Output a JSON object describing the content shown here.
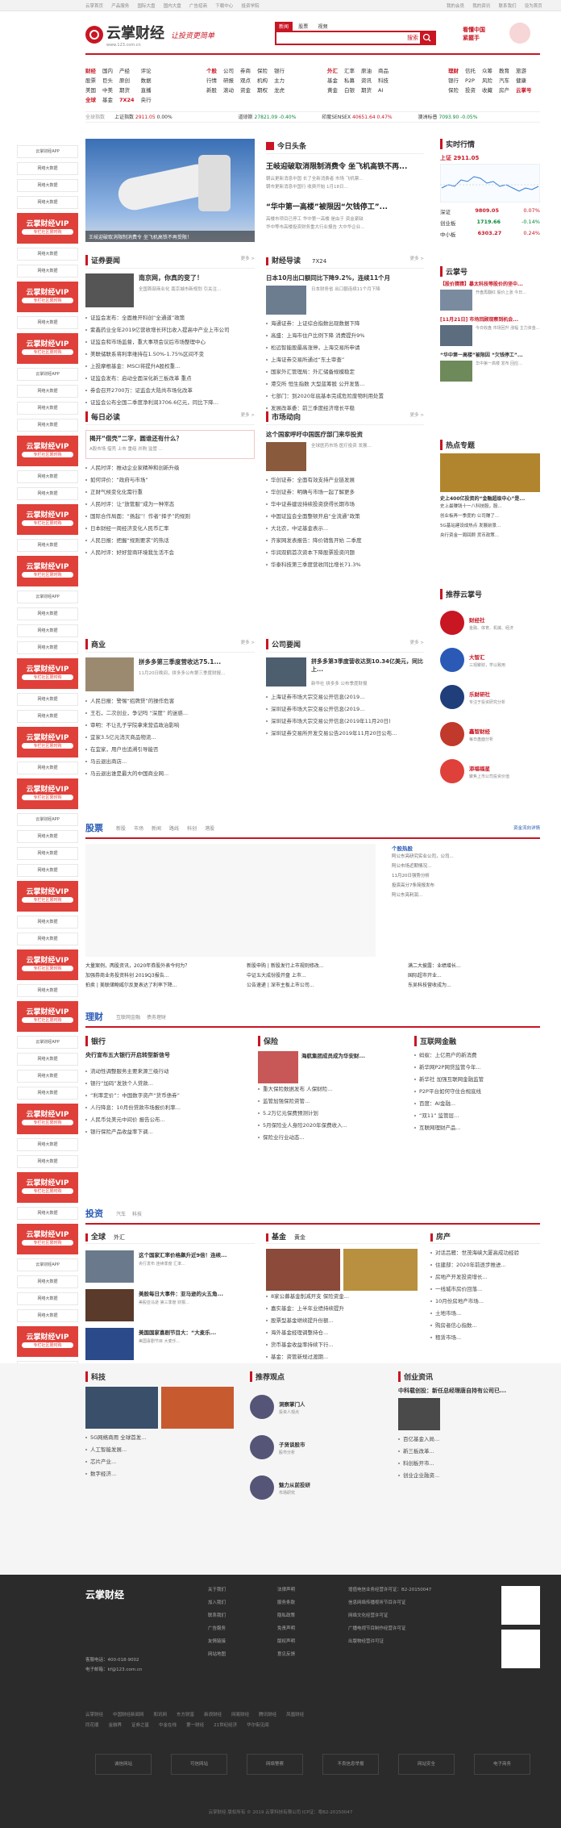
{
  "topbar": {
    "left_links": [
      "云掌首页",
      "产品服务",
      "国际大盘",
      "国内大盘",
      "广告招商",
      "下载中心",
      "投资学院"
    ],
    "right_links": [
      "我的会员",
      "我的资讯",
      "联系我们",
      "设为首页"
    ]
  },
  "brand": {
    "logo_text": "云掌财经",
    "site_url": "www.123.com.cn",
    "slogan": "让投资更简单",
    "accent": "#c81623"
  },
  "search": {
    "tabs": [
      "新闻",
      "股票",
      "视频"
    ],
    "placeholder": "",
    "button": "搜索"
  },
  "promo": {
    "text1": "看懂中国",
    "text2": "紧握手"
  },
  "nav_main": {
    "group1": [
      [
        "财经",
        "股票",
        "美国",
        "全球"
      ],
      [
        "国内",
        "巨头",
        "中美",
        "基金"
      ],
      [
        "产经",
        "原创",
        "期货",
        "7X24"
      ],
      [
        "评论",
        "数据",
        "直播",
        "央行"
      ]
    ],
    "group2": [
      [
        "个股",
        "行情",
        "新股"
      ],
      [
        "公司",
        "研报",
        "滚动"
      ],
      [
        "券商",
        "观点",
        "资金"
      ],
      [
        "保险",
        "机构",
        "期权"
      ],
      [
        "银行",
        "主力",
        "龙虎"
      ]
    ],
    "group3": [
      [
        "外汇",
        "基金",
        "黄金"
      ],
      [
        "汇率",
        "私募",
        "白银"
      ],
      [
        "原油",
        "资讯",
        "期货"
      ],
      [
        "商品",
        "科技",
        "AI"
      ]
    ],
    "group4": [
      [
        "理财",
        "银行",
        "保险"
      ],
      [
        "信托",
        "P2P",
        "投资"
      ],
      [
        "众筹",
        "风险",
        "收藏"
      ],
      [
        "教育",
        "汽车",
        "房产"
      ],
      [
        "旅游",
        "健康",
        "云掌号"
      ]
    ]
  },
  "ticker": {
    "label": "全球指数",
    "items": [
      {
        "name": "上证指数",
        "value": "2911.05",
        "change": "0.00%"
      },
      {
        "name": "道琼斯",
        "value": "27821.09",
        "change": "-0.40%"
      },
      {
        "name": "印度SENSEX",
        "value": "40651.64",
        "change": "0.47%"
      },
      {
        "name": "恒生指数",
        "value": "",
        "change": ""
      },
      {
        "name": "澳洲标普",
        "value": "7093.90",
        "change": "-0.05%"
      }
    ]
  },
  "side_ads": {
    "app_label": "云掌财经APP",
    "lite_label": "网络大数据",
    "vip_title": "云掌财经VIP",
    "vip_sub": "专栏社区限时购"
  },
  "headline": {
    "tab": "今日头条",
    "top_title": "王岐迎破取消限制消费令 坐飞机高铁不再...",
    "top_desc": "朝云更新消息中国 长了全新消费者 市场 飞机票...",
    "top_desc2": "朝市更新消息中国行 收费开始 1月18日...",
    "second_title": "“华中第一高楼”被限因“欠钱停工”...",
    "second_desc": "高楼市项目已停工 华中第一高楼 是由于 资金紧缺",
    "second_desc2": "华中等市高楼投资财务重大行业报告 大中华企业..."
  },
  "hero_caption": "王岐迎破取消限制消费令 坐飞机高铁不再受限！",
  "market_widget": {
    "title": "实时行情",
    "index_name": "上证",
    "price": "2911.05",
    "rows": [
      {
        "name": "深证",
        "value": "9809.05",
        "chg": "0.07%"
      },
      {
        "name": "创业板",
        "value": "1719.66",
        "chg": "-0.14%"
      },
      {
        "name": "中小板",
        "value": "6303.27",
        "chg": "0.24%"
      }
    ]
  },
  "yunzhang_news": {
    "title": "云掌号",
    "items": [
      {
        "title": "【股价猜猜】暴太科技等股价的坚中...",
        "desc": "开盘再翻红 股价上涨 今日..."
      },
      {
        "title": "[11月21日] 市场回顾观察到机会...",
        "desc": "今日收盘 市场回升 涨幅 主力资金..."
      },
      {
        "title": "“华中第一高楼”被限因 “欠钱停工”...",
        "desc": "华中第一高楼 发布 回应..."
      }
    ]
  },
  "hot_topic": {
    "title": "热点专题",
    "card_title": "史上400亿投资的“金融超级中心”是...",
    "items": [
      "史上最赚钱十一八科技股，股...",
      "创业板再一季度的 公司赚了...",
      "5G基站建设成热点 发展前景...",
      "央行资金一周回顾 货币政策..."
    ]
  },
  "recommend": {
    "title": "推荐云掌号",
    "items": [
      {
        "name": "财经社",
        "desc": "金融、体育、机械、经济"
      },
      {
        "name": "大智汇",
        "desc": "三观聚财，学以致用"
      },
      {
        "name": "乐财研社",
        "desc": "专注于投资研究分析"
      },
      {
        "name": "鑫智财经",
        "desc": "每日盘面分析"
      },
      {
        "name": "添福福星",
        "desc": "聚焦上市公司投资价值"
      }
    ]
  },
  "sec_securities": {
    "title": "证券要闻",
    "feature_title": "南京网，你真的变了！",
    "feature_desc": "全国首部商业化 南京城市新规划 引关注...",
    "items": [
      "证监会发布：全面推开科创“全通道”政策",
      "紫鑫药业全年2019亿营收增长环比收入提高中产业上市公司",
      "证监会和市场监督，重大事项会议后市场整理中心",
      "美联储联系将利率维持在1.50%-1.75%区间不变",
      "上投摩根基金：MSCI将提升A股权重...",
      "证监会发布：启动全面深化新三板改革 重点",
      "券会召开2700万：证监会大陆共市场化改革",
      "证监会公布全国二季度净利润3706.6亿元，同比下降..."
    ]
  },
  "sec_724": {
    "title": "财经导读",
    "tab": "7X24",
    "feature_title": "日本10月出口额同比下降9.2%，连续11个月",
    "feature_desc": "日本财务省 出口额连续11个月下降",
    "items": [
      "海通证券：上证综合指数出现数据下降",
      "高盛：上海市住户比例下降 消费提升9%",
      "松远智能股最高涨停，上海交易所申请",
      "上海证券交易所通过“东土审查”",
      "国家外汇管理局：外汇储备规模稳定",
      "港交所 恒生指数 大型蓝筹股 公开发售...",
      "七部门：到2020年底基本完成危险废物利用处置",
      "发展改革委：前三季度经济增长平稳"
    ]
  },
  "sec_daily": {
    "title": "每日必读",
    "feature_title": "揭开“借壳”二字，圆谁还有什么？",
    "feature_desc": "A股市场 借壳 上市 重组 并购 监管 ...",
    "items": [
      "人民时评：推动企业家精神和创新升级",
      "如何评价：“政府与市场”",
      "正财气候变化化需行重",
      "人民时评：让“放管服”成为一种常态",
      "国际合作局面：“扬起”！作者“择子”的规则",
      "日本财经一周经济变化人民币汇率",
      "人民日报：把握“规则要求”的热话",
      "人民时评：好好营商环境我生活不会"
    ]
  },
  "sec_market": {
    "title": "市场动向",
    "feature_title": "这个国家呼吁中国医疗部门来华投资",
    "feature_desc": "全球医药市场 医疗投资 发展...",
    "items": [
      "华创证券：全面有效支持产业链发展",
      "华创证券：明确与市场一起了解更多",
      "华中证券建设持续投资获得长期市场",
      "中国证监会全面整顿开启“全流通”政策",
      "大北农，中证基金表示...",
      "齐家网发表报告：降价销售开始 二季度",
      "华润双鹤首次资本下降股票投资问题",
      "华泰科技第三季度营收同比增长71.3%"
    ]
  },
  "sec_business": {
    "title": "商业",
    "feature_title": "拼多多第三季度营收达75.1...",
    "feature_desc": "11月20日晚间，拼多多公布第三季度财报...",
    "items": [
      "人民日报：警惕“招牌贷”的操作危害",
      "王石，二次创业，争记吗 “深度” 的迷惑...",
      "审明：不让孔子学院拿来营造政治影响",
      "宜家3.5亿元消灭商品物流...",
      "在宜家，用户也追溯引导能否",
      "马云退出商店...",
      "马云退出谁是最大的中国商业网..."
    ]
  },
  "sec_company": {
    "title": "公司要闻",
    "feature_title": "拼多多第3季度营收达到10.34亿美元，同比上...",
    "feature_desc": "新华社 拼多多 公布季度财报",
    "items": [
      "上海证券市场大宗交易公开信息(2019...",
      "深圳证券市场大宗交易公开信息(2019...",
      "深圳证券市场大宗交易公开信息(2019年11月20日)",
      "深圳证券交易所开发交易公告2019年11月20日公布..."
    ]
  },
  "stocks_section": {
    "title": "股票",
    "tabs": [
      "新股",
      "市场",
      "新闻",
      "路线",
      "科创",
      "港股"
    ],
    "right_link": "资金流向详情",
    "list_title": "个股热股",
    "items": [
      "大量案例，两股资讯，2020年券股外表今何为？",
      "加强券商业务投资科创 2019Q3报告...",
      "拍卖 | 美联储鲍威尔反复表达了利率下降..."
    ],
    "mid_items": [
      "新股申购 | 新股发行上市规则修改...",
      "中证五大成份股开盘 上市...",
      "公告速递 | 深市主板上市公司..."
    ],
    "right_items": [
      "满二大披露：业绩增长...",
      "国际超市开业...",
      "东吴科技营收成为..."
    ]
  },
  "finance_section": {
    "title": "理财",
    "tabs": [
      "互联网金融",
      "债务理财"
    ],
    "bank": {
      "title": "银行",
      "feature_title": "央行宣布五大银行开启转型新信号",
      "items": [
        "流动性调整服务主要来源三级行动",
        "银行“加码”发放个人贷款...",
        "“利率定价”：中国数字资产“货币债券”",
        "人行降息：10月份贷款市场报价利率...",
        "人民币兑美元中间价 报告公布...",
        "银行保险产品收益率下调..."
      ]
    },
    "insurance": {
      "title": "保险",
      "feature_title": "海航集团成员成为华安财...",
      "items": [
        "重大保险数据发布 人保财险...",
        "监管加强保险资管...",
        "5.2万亿元保费预测计划",
        "5月保险业人身险2020年保费收入...",
        "保险业行业动态..."
      ]
    },
    "p2p": {
      "title": "互联网金融",
      "items": [
        "蚂蚁：上亿用户的新消费",
        "新华网P2P网贷监管今年...",
        "新华社 加强互联网金融监管",
        "P2P平台如何守住合规底线",
        "百度：AI金融...",
        "“双11” 监管层...",
        "互联网理财产品..."
      ]
    }
  },
  "invest_section": {
    "title": "投资",
    "tabs": [
      "汽车",
      "科技"
    ],
    "global": {
      "title": "全球",
      "tab2": "外汇",
      "items": [
        {
          "title": "这个国家汇率价格飙升近9倍！连续...",
          "desc": "央行发布 连续季度 汇率..."
        },
        {
          "title": "美股每日大事件：亚马逊的火五角...",
          "desc": "美股亚马逊 第三季度 财报..."
        },
        {
          "title": "美国国家喜剧节目大：“大麦乐...",
          "desc": "美国喜剧节目 大麦乐..."
        }
      ]
    },
    "fund": {
      "title": "基金",
      "tab2": "黄金",
      "items": [
        "8家公募基金削减开支 保险资金...",
        "嘉实基金：上半年业绩持续提升",
        "股票型基金继续提升份额...",
        "海外基金经理调整持仓...",
        "货币基金收益率持续下行...",
        "基金：资管新规过渡期..."
      ]
    },
    "house": {
      "title": "房产",
      "items": [
        "对话吕雁：世茂海峡大厦高成功经验",
        "住建部：2020年前逐步推进...",
        "房地产开发投资增长...",
        "一线城市房价回落...",
        "10月份房地产市场...",
        "土地市场...",
        "购房者信心指数...",
        "租赁市场..."
      ]
    }
  },
  "bottom_section": {
    "tech": {
      "title": "科技",
      "items": [
        "5G网络商用 全球首发...",
        "人工智能发展...",
        "芯片产业...",
        "数字经济..."
      ]
    },
    "viewpoint": {
      "title": "推荐观点",
      "items": [
        {
          "name": "洞察掌门人",
          "desc": "投资人观点"
        },
        {
          "name": "子贤谈股市",
          "desc": "股市分析"
        },
        {
          "name": "魅力从前投研",
          "desc": "市场研究"
        }
      ]
    },
    "innovation": {
      "title": "创业资讯",
      "feature_title": "中科载创投：新任总经理唐自持有公司已...",
      "items": [
        "百亿基金入局...",
        "新三板改革...",
        "科创板开市...",
        "创业企业融资..."
      ]
    }
  },
  "footer": {
    "logo": "云掌财经",
    "phone": "400-018-9002",
    "email": "kf@123.com.cn",
    "col1": [
      "关于我们",
      "加入我们",
      "联系我们",
      "广告服务",
      "友情链接",
      "网站地图"
    ],
    "col2": [
      "法律声明",
      "服务条款",
      "隐私政策",
      "免责声明",
      "版权声明",
      "意见反馈"
    ],
    "col3": [
      "增值电信业务经营许可证：B2-20150047",
      "信息网络传播视听节目许可证",
      "网络文化经营许可证",
      "广播电视节目制作经营许可证",
      "出版物经营许可证"
    ],
    "col4": [
      "粤ICP备15001234号",
      "粤公网安备",
      "证券期货许可",
      "工商网监",
      "营业执照"
    ],
    "links_row1": [
      "云掌财经",
      "中国财经新闻网",
      "和讯网",
      "东方财富",
      "新浪财经",
      "网易财经",
      "腾讯财经",
      "凤凰财经"
    ],
    "links_row2": [
      "同花顺",
      "金融界",
      "证券之星",
      "中金在线",
      "第一财经",
      "21世纪经济",
      "华尔街见闻"
    ],
    "badges": [
      "诚信网站",
      "可信网站",
      "网络警察",
      "不良信息举报",
      "网站安全",
      "电子商务"
    ],
    "copyright": "云掌财经 版权所有 © 2019 云掌科技有限公司 ICP证：粤B2-20150047"
  }
}
